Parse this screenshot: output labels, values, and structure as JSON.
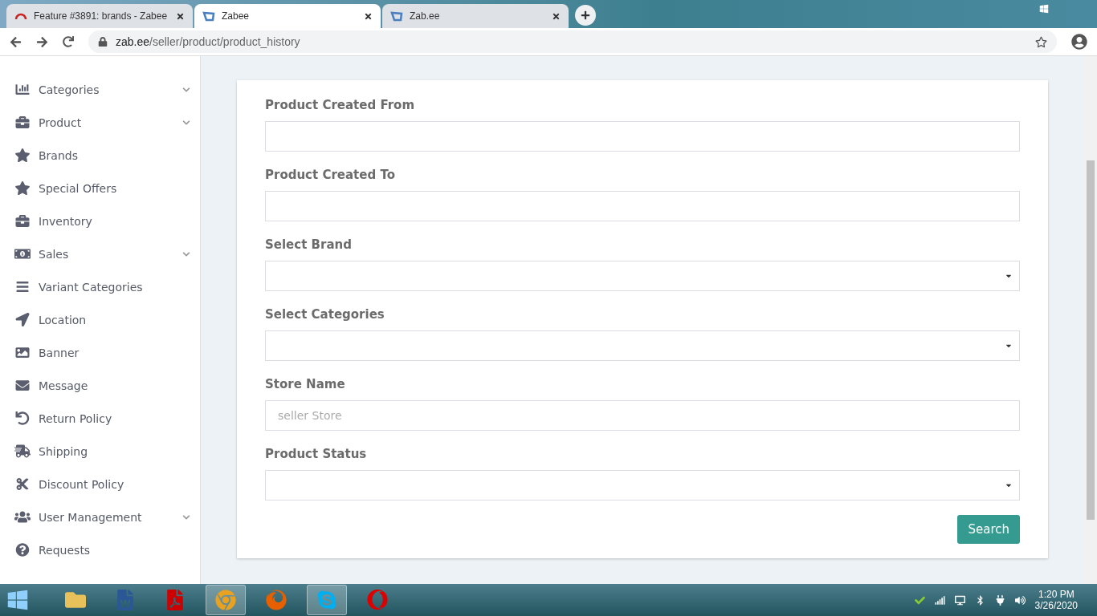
{
  "browser": {
    "tabs": [
      {
        "title": "Feature #3891: brands - Zabee",
        "selected": false
      },
      {
        "title": "Zabee",
        "selected": true
      },
      {
        "title": "Zab.ee",
        "selected": false
      }
    ],
    "address": {
      "host": "zab.ee",
      "path": "/seller/product/product_history"
    }
  },
  "sidebar": {
    "items": [
      {
        "label": "Categories",
        "expandable": true
      },
      {
        "label": "Product",
        "expandable": true
      },
      {
        "label": "Brands",
        "expandable": false
      },
      {
        "label": "Special Offers",
        "expandable": false
      },
      {
        "label": "Inventory",
        "expandable": false
      },
      {
        "label": "Sales",
        "expandable": true
      },
      {
        "label": "Variant Categories",
        "expandable": false
      },
      {
        "label": "Location",
        "expandable": false
      },
      {
        "label": "Banner",
        "expandable": false
      },
      {
        "label": "Message",
        "expandable": false
      },
      {
        "label": "Return Policy",
        "expandable": false
      },
      {
        "label": "Shipping",
        "expandable": false
      },
      {
        "label": "Discount Policy",
        "expandable": false
      },
      {
        "label": "User Management",
        "expandable": true
      },
      {
        "label": "Requests",
        "expandable": false
      }
    ]
  },
  "form": {
    "fields": [
      {
        "label": "Product Created From",
        "kind": "text"
      },
      {
        "label": "Product Created To",
        "kind": "text"
      },
      {
        "label": "Select Brand",
        "kind": "select"
      },
      {
        "label": "Select Categories",
        "kind": "select"
      },
      {
        "label": "Store Name",
        "kind": "text",
        "placeholder": "seller Store"
      },
      {
        "label": "Product Status",
        "kind": "select"
      }
    ],
    "submit": "Search"
  },
  "taskbar": {
    "time": "1:20 PM",
    "date": "3/26/2020"
  }
}
